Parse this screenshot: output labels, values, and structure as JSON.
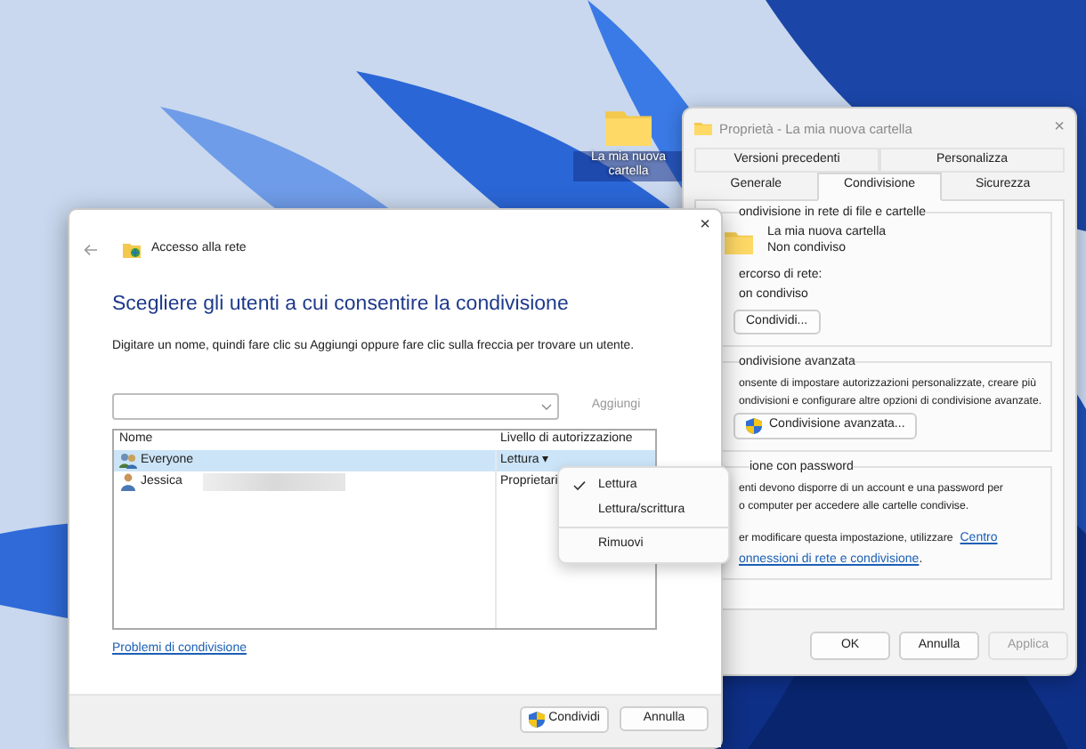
{
  "desktop": {
    "icon_label": "La mia nuova cartella"
  },
  "properties": {
    "title": "Proprietà - La mia nuova cartella",
    "close": "×",
    "tab_rows": [
      [
        {
          "label": "Versioni precedenti",
          "selected": false
        },
        {
          "label": "Personalizza",
          "selected": false
        }
      ],
      [
        {
          "label": "Generale",
          "selected": false
        },
        {
          "label": "Condivisione",
          "selected": true
        },
        {
          "label": "Sicurezza",
          "selected": false
        }
      ]
    ],
    "network_group": {
      "title": "ondivisione in rete di file e cartelle",
      "folder_name": "La mia nuova cartella",
      "folder_status": "Non condiviso",
      "path_label": "ercorso di rete:",
      "path_value": "on condiviso",
      "button": "Condividi..."
    },
    "advanced_group": {
      "title": "ondivisione avanzata",
      "lines": [
        "onsente di impostare autorizzazioni personalizzate, creare più",
        "ondivisioni e configurare altre opzioni di condivisione avanzate."
      ],
      "button": "Condivisione avanzata..."
    },
    "password_group": {
      "title": "ione con password",
      "lines": [
        "enti devono disporre di un account e una password per",
        "o computer per accedere alle cartelle condivise."
      ],
      "note": "er modificare questa impostazione, utilizzare",
      "link_start": "Centro",
      "link_end": "onnessioni di rete e condivisione",
      "note_end": "."
    },
    "buttons": [
      {
        "label": "OK",
        "disabled": false
      },
      {
        "label": "Annulla",
        "disabled": false
      },
      {
        "label": "Applica",
        "disabled": true
      }
    ]
  },
  "dialog": {
    "close": "×",
    "title": "Accesso alla rete",
    "heading": "Scegliere gli utenti a cui consentire la condivisione",
    "description": "Digitare un nome, quindi fare clic su Aggiungi oppure fare clic sulla freccia per trovare un utente.",
    "add_button": {
      "label": "Aggiungi",
      "disabled": true
    },
    "columns": [
      "Nome",
      "Livello di autorizzazione"
    ],
    "rows": [
      {
        "kind": "group",
        "name": "Everyone",
        "level": "Lettura ▾",
        "selected": true,
        "redacted": false
      },
      {
        "kind": "user",
        "name": "Jessica",
        "level": "Proprietari",
        "selected": false,
        "redacted": true
      }
    ],
    "help_link": "Problemi di condivisione",
    "buttons": [
      {
        "label": "Condividi",
        "shield": true
      },
      {
        "label": "Annulla",
        "shield": false
      }
    ]
  },
  "menu": [
    {
      "kind": "item",
      "label": "Lettura",
      "checked": true
    },
    {
      "kind": "item",
      "label": "Lettura/scrittura",
      "checked": false
    },
    {
      "kind": "separator"
    },
    {
      "kind": "item",
      "label": "Rimuovi",
      "checked": false
    }
  ]
}
